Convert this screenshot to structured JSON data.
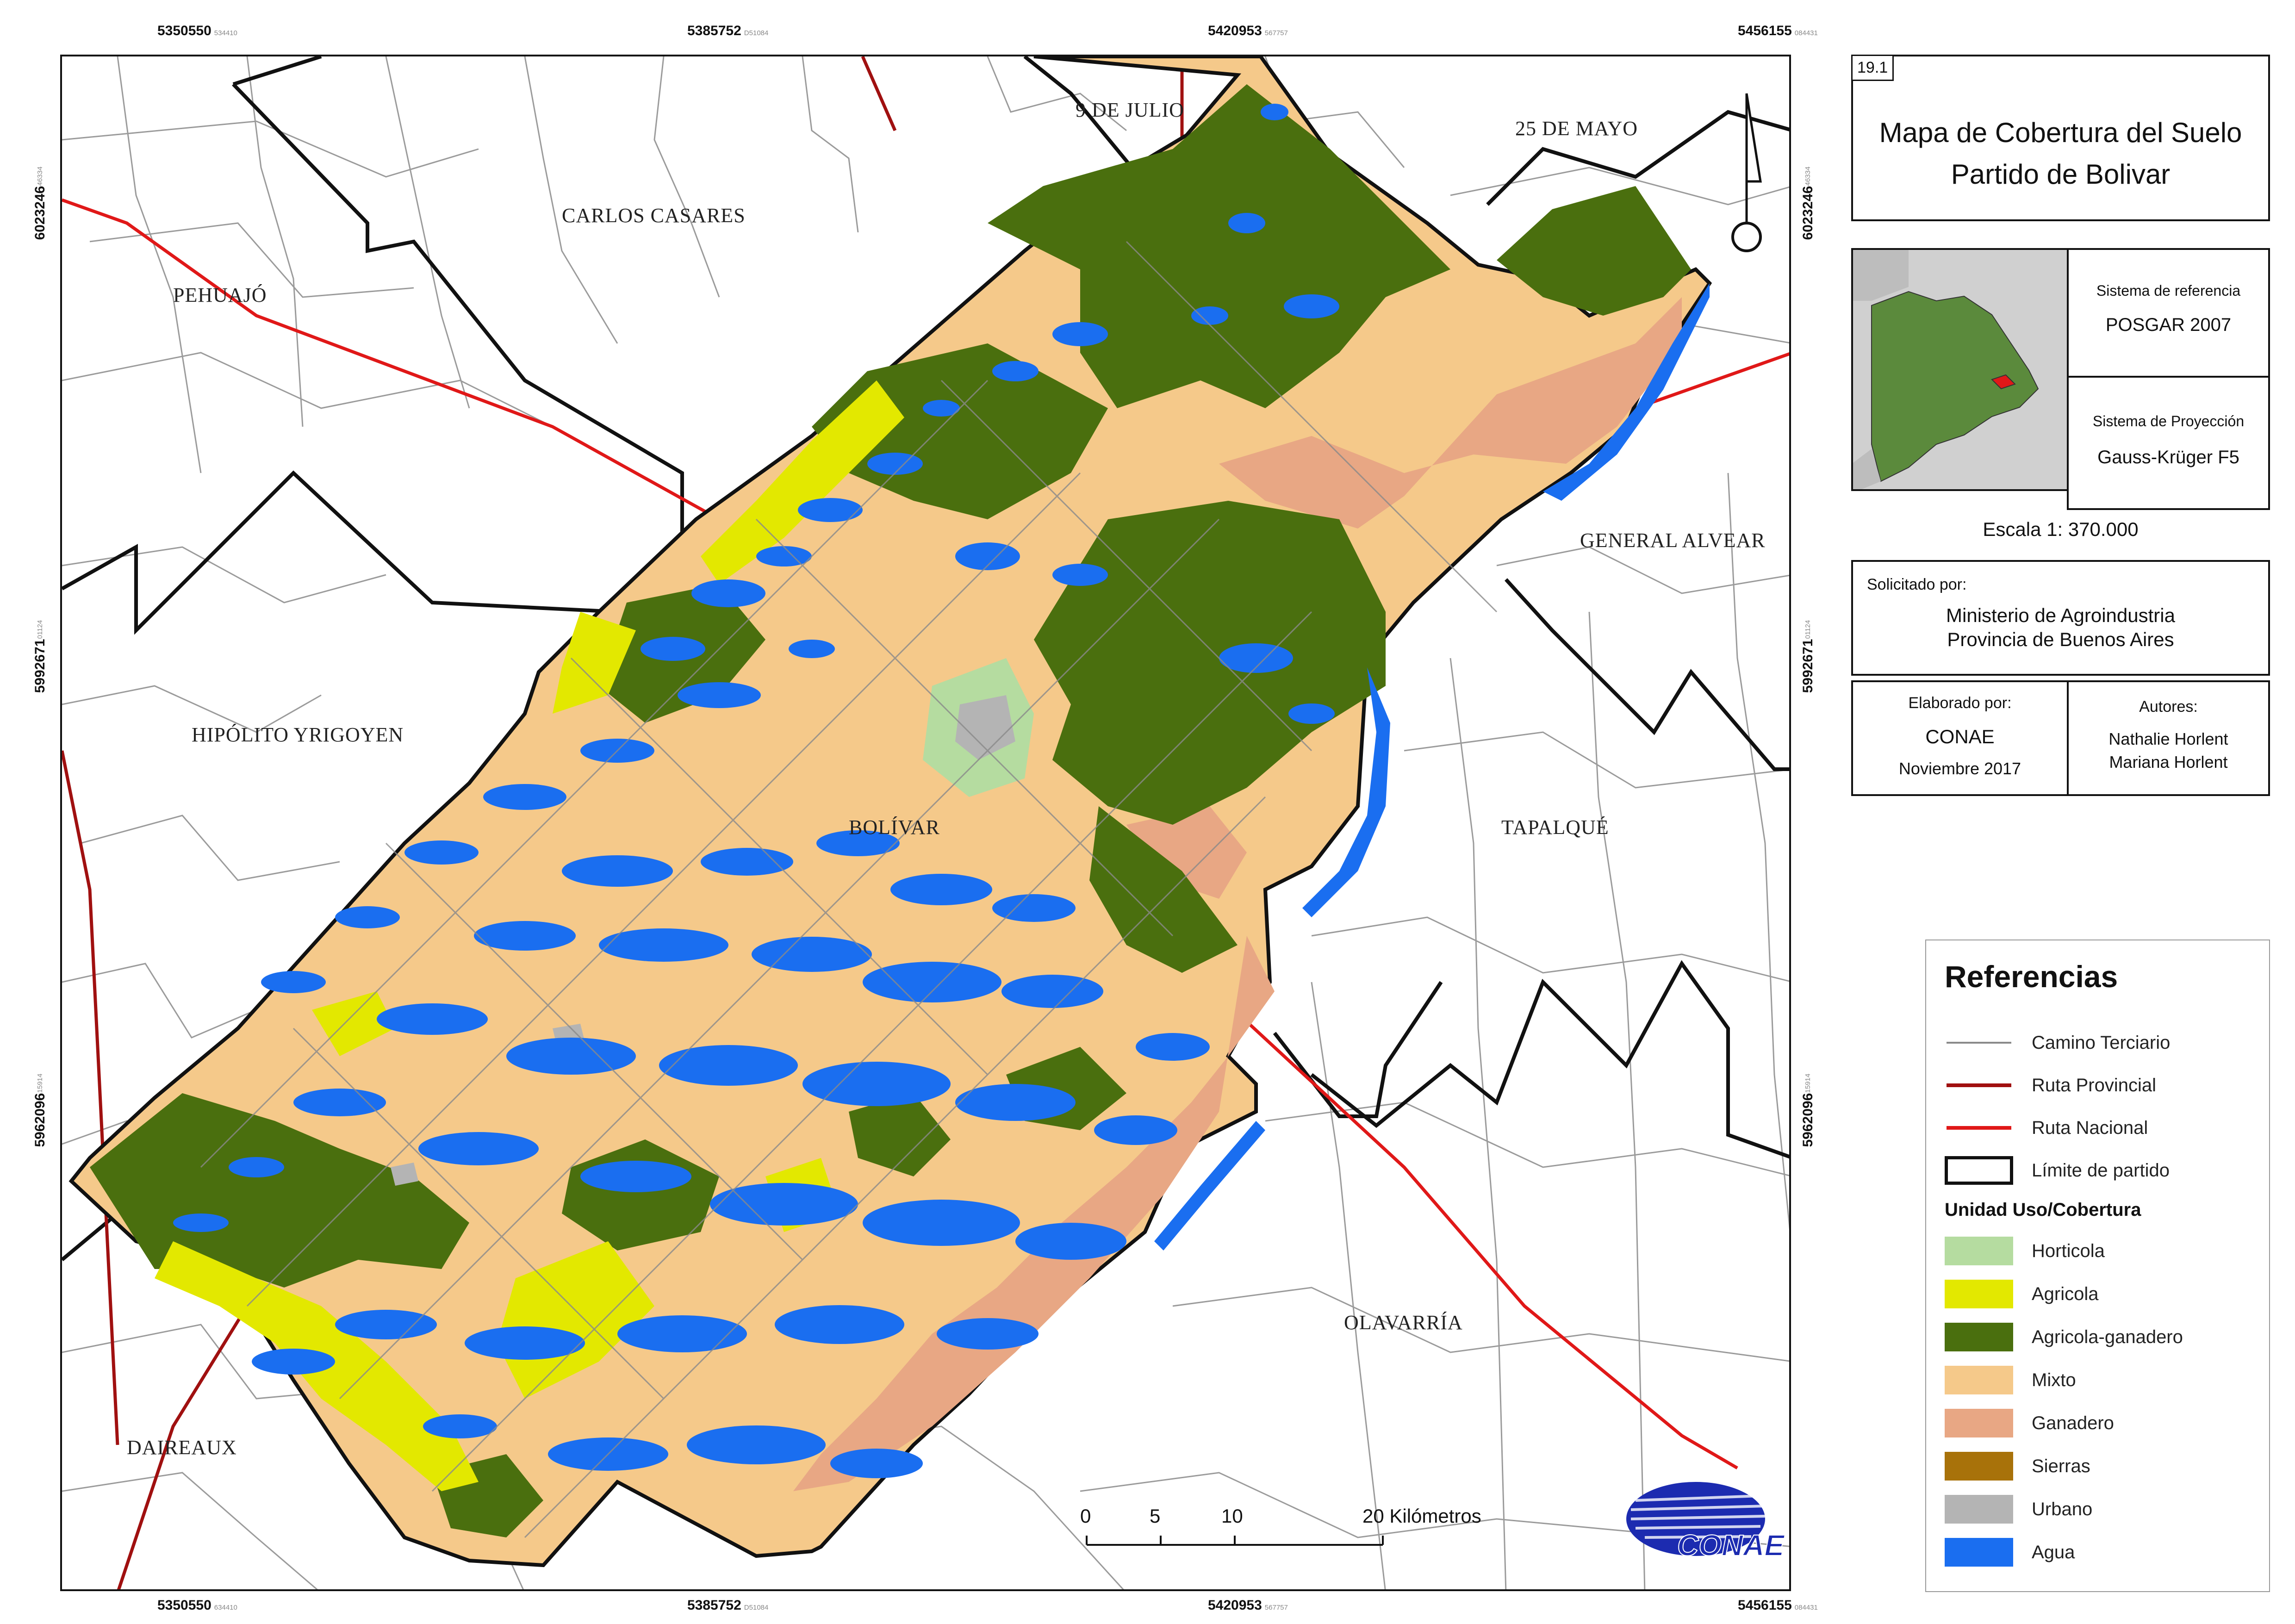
{
  "coords": {
    "top": [
      "5350550",
      "5385752",
      "5420953",
      "5456155"
    ],
    "top_small": [
      "534410",
      "D51084",
      "567757",
      "084431"
    ],
    "bottom": [
      "5350550",
      "5385752",
      "5420953",
      "5456155"
    ],
    "bottom_small": [
      "634410",
      "D51084",
      "567757",
      "084431"
    ],
    "left": [
      "6023246",
      "5992671",
      "5962096"
    ],
    "right": [
      "6023246",
      "5992671",
      "5962096"
    ],
    "side_small": [
      "46334",
      "01124",
      "15914"
    ]
  },
  "places": {
    "nueve_de_julio": "9 DE JULIO",
    "veinticinco_de_mayo": "25 DE MAYO",
    "carlos_casares": "CARLOS CASARES",
    "pehuajo": "PEHUAJÓ",
    "general_alvear": "GENERAL ALVEAR",
    "hipolito_yrigoyen": "HIPÓLITO YRIGOYEN",
    "bolivar": "BOLÍVAR",
    "tapalque": "TAPALQUÉ",
    "olavarria": "OLAVARRÍA",
    "daireaux": "DAIREAUX"
  },
  "panel": {
    "map_number": "19.1",
    "title_line1": "Mapa de Cobertura del Suelo",
    "title_line2": "Partido de Bolivar",
    "ref_system_label": "Sistema de referencia",
    "ref_system_value": "POSGAR 2007",
    "projection_label": "Sistema de Proyección",
    "projection_value": "Gauss-Krüger F5",
    "scale": "Escala 1: 370.000",
    "requested_label": "Solicitado por:",
    "requested_line1": "Ministerio de Agroindustria",
    "requested_line2": "Provincia de Buenos Aires",
    "made_by_label": "Elaborado por:",
    "made_by_value": "CONAE",
    "made_date": "Noviembre 2017",
    "authors_label": "Autores:",
    "author1": "Nathalie Horlent",
    "author2": "Mariana Horlent"
  },
  "legend": {
    "title": "Referencias",
    "lines": [
      {
        "label": "Camino Terciario",
        "color": "#8a8a8a"
      },
      {
        "label": "Ruta Provincial",
        "color": "#a01010"
      },
      {
        "label": "Ruta Nacional",
        "color": "#e01818"
      },
      {
        "label": "Límite de partido",
        "color": "#111111"
      }
    ],
    "subtitle": "Unidad Uso/Cobertura",
    "classes": [
      {
        "label": "Horticola",
        "color": "#b5dca0"
      },
      {
        "label": "Agricola",
        "color": "#e3e800"
      },
      {
        "label": "Agricola-ganadero",
        "color": "#4a6f0e"
      },
      {
        "label": "Mixto",
        "color": "#f5c98a"
      },
      {
        "label": "Ganadero",
        "color": "#e8a784"
      },
      {
        "label": "Sierras",
        "color": "#a8720a"
      },
      {
        "label": "Urbano",
        "color": "#b4b4b4"
      },
      {
        "label": "Agua",
        "color": "#1a6ef0"
      }
    ]
  },
  "scalebar": {
    "ticks": [
      "0",
      "5",
      "10",
      "20 Kilómetros"
    ]
  },
  "logo": {
    "text": "CONAE"
  }
}
